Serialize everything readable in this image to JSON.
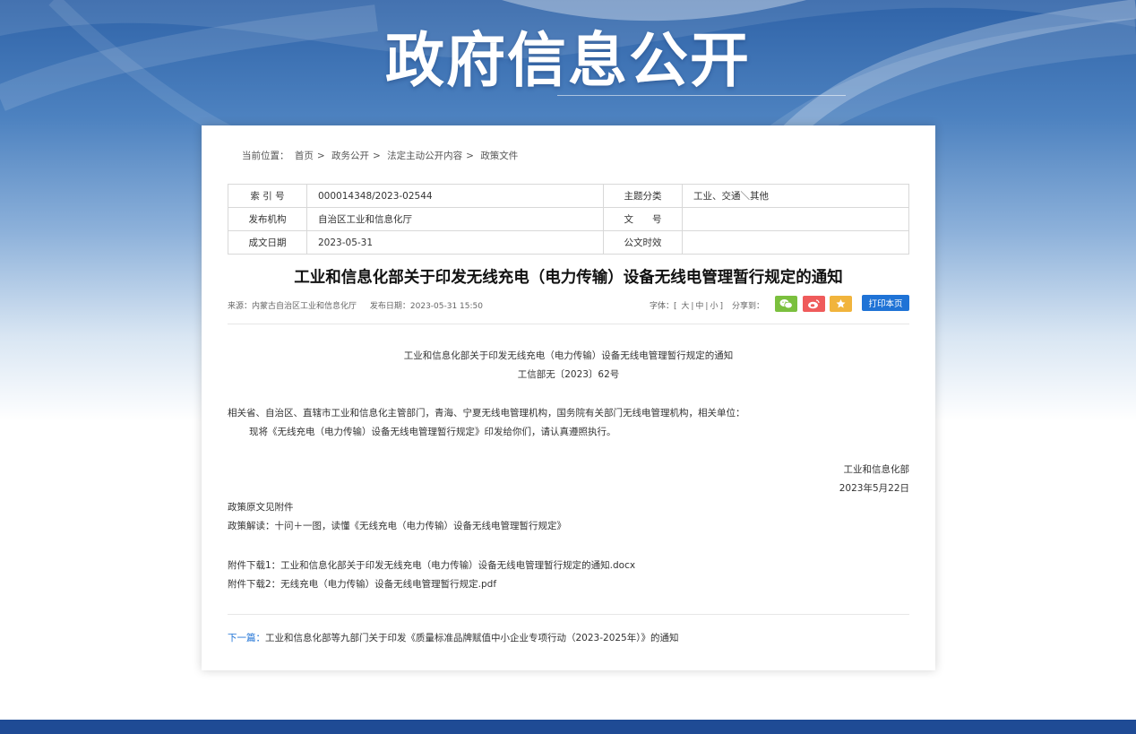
{
  "hero": {
    "title": "政府信息公开"
  },
  "breadcrumb": {
    "prefix": "当前位置：",
    "items": [
      "首页",
      "政务公开",
      "法定主动公开内容",
      "政策文件"
    ],
    "separator": ">"
  },
  "meta_table": {
    "rows": [
      {
        "label1": "索 引 号",
        "value1": "000014348/2023-02544",
        "label2": "主题分类",
        "value2": "工业、交通＼其他"
      },
      {
        "label1": "发布机构",
        "value1": "自治区工业和信息化厅",
        "label2": "文　　号",
        "value2": ""
      },
      {
        "label1": "成文日期",
        "value1": "2023-05-31",
        "label2": "公文时效",
        "value2": ""
      }
    ]
  },
  "article": {
    "title": "工业和信息化部关于印发无线充电（电力传输）设备无线电管理暂行规定的通知",
    "source": "来源：内蒙古自治区工业和信息化厅",
    "publish_date": "发布日期：2023-05-31 15:50",
    "font_label": "字体：",
    "font_open": "[",
    "font_sizes": [
      "大",
      "中",
      "小"
    ],
    "font_sep": "|",
    "font_close": "]",
    "share_label": "分享到：",
    "share_buttons": [
      {
        "name": "wechat",
        "color": "#7bc03e"
      },
      {
        "name": "weibo",
        "color": "#ef5b5b"
      },
      {
        "name": "favorite",
        "color": "#f1b43c"
      }
    ],
    "print_label": "打印本页",
    "heading_line1": "工业和信息化部关于印发无线充电（电力传输）设备无线电管理暂行规定的通知",
    "doc_number": "工信部无〔2023〕62号",
    "recipients": "相关省、自治区、直辖市工业和信息化主管部门，青海、宁夏无线电管理机构，国务院有关部门无线电管理机构，相关单位：",
    "body": "现将《无线充电（电力传输）设备无线电管理暂行规定》印发给你们，请认真遵照执行。",
    "signature": "工业和信息化部",
    "sign_date": "2023年5月22日",
    "original_note": "政策原文见附件",
    "interpretation": "政策解读：十问＋一图，读懂《无线充电（电力传输）设备无线电管理暂行规定》",
    "attachments": [
      "附件下载1：工业和信息化部关于印发无线充电（电力传输）设备无线电管理暂行规定的通知.docx",
      "附件下载2：无线充电（电力传输）设备无线电管理暂行规定.pdf"
    ],
    "next_label": "下一篇：",
    "next_title": "工业和信息化部等九部门关于印发《质量标准品牌赋值中小企业专项行动（2023-2025年）》的通知"
  },
  "colors": {
    "hero_blue": "#2f63a8",
    "link_blue": "#1f73d6",
    "footer_blue": "#1f4b95"
  }
}
